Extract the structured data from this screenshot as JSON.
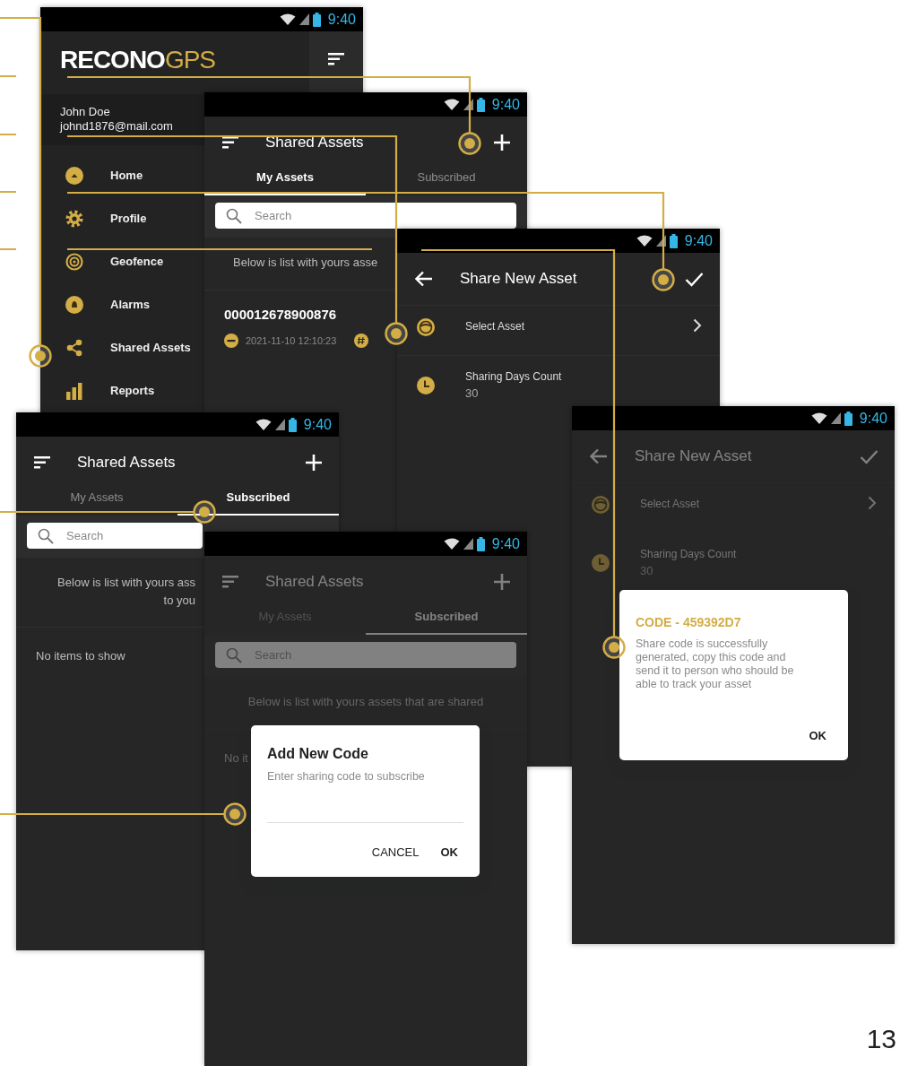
{
  "screens": [
    {
      "kind": "drawer",
      "status_time": "9:40",
      "logo": {
        "text": "RECONO",
        "accent": "GPS"
      },
      "user": {
        "name": "John Doe",
        "email": "johnd1876@mail.com"
      },
      "menu": [
        {
          "label": "Home"
        },
        {
          "label": "Profile"
        },
        {
          "label": "Geofence"
        },
        {
          "label": "Alarms"
        },
        {
          "label": "Shared Assets"
        },
        {
          "label": "Reports"
        }
      ]
    },
    {
      "kind": "list",
      "status_time": "9:40",
      "title": "Shared Assets",
      "tabs": [
        {
          "label": "My Assets",
          "selected": true
        },
        {
          "label": "Subscribed",
          "selected": false
        }
      ],
      "search": {
        "placeholder": "Search"
      },
      "note_lines": [
        "Below is list with yours asse"
      ],
      "items": [
        {
          "id": "000012678900876",
          "date": "2021-11-10 12:10:23"
        }
      ]
    },
    {
      "kind": "form",
      "status_time": "9:40",
      "title": "Share New Asset",
      "fields": [
        {
          "kind": "select",
          "label": "Select Asset"
        },
        {
          "kind": "value",
          "label": "Sharing Days Count",
          "value": "30"
        }
      ]
    },
    {
      "kind": "list",
      "status_time": "9:40",
      "title": "Shared Assets",
      "tabs": [
        {
          "label": "My Assets",
          "selected": false
        },
        {
          "label": "Subscribed",
          "selected": true
        }
      ],
      "search": {
        "placeholder": "Search"
      },
      "note_lines": [
        "Below is list with yours ass",
        "to you"
      ],
      "empty": "No items to show"
    },
    {
      "kind": "list",
      "status_time": "9:40",
      "title": "Shared Assets",
      "tabs": [
        {
          "label": "My Assets",
          "selected": false
        },
        {
          "label": "Subscribed",
          "selected": true
        }
      ],
      "search": {
        "placeholder": "Search"
      },
      "note_lines": [
        "Below is list with yours assets that are shared"
      ],
      "empty": "No it",
      "dialog": {
        "kind": "input",
        "title": "Add New Code",
        "message": "Enter sharing code to subscribe",
        "buttons": [
          "CANCEL",
          "OK"
        ]
      }
    },
    {
      "kind": "form",
      "status_time": "9:40",
      "title": "Share New Asset",
      "fields": [
        {
          "kind": "select",
          "label": "Select Asset"
        },
        {
          "kind": "value",
          "label": "Sharing Days Count",
          "value": "30"
        }
      ],
      "dialog": {
        "kind": "info",
        "title": "CODE - 459392D7",
        "message": "Share code is successfully generated, copy this code and send it to person who should be able to track your asset",
        "buttons": [
          "OK"
        ]
      }
    }
  ],
  "page_number": "13"
}
